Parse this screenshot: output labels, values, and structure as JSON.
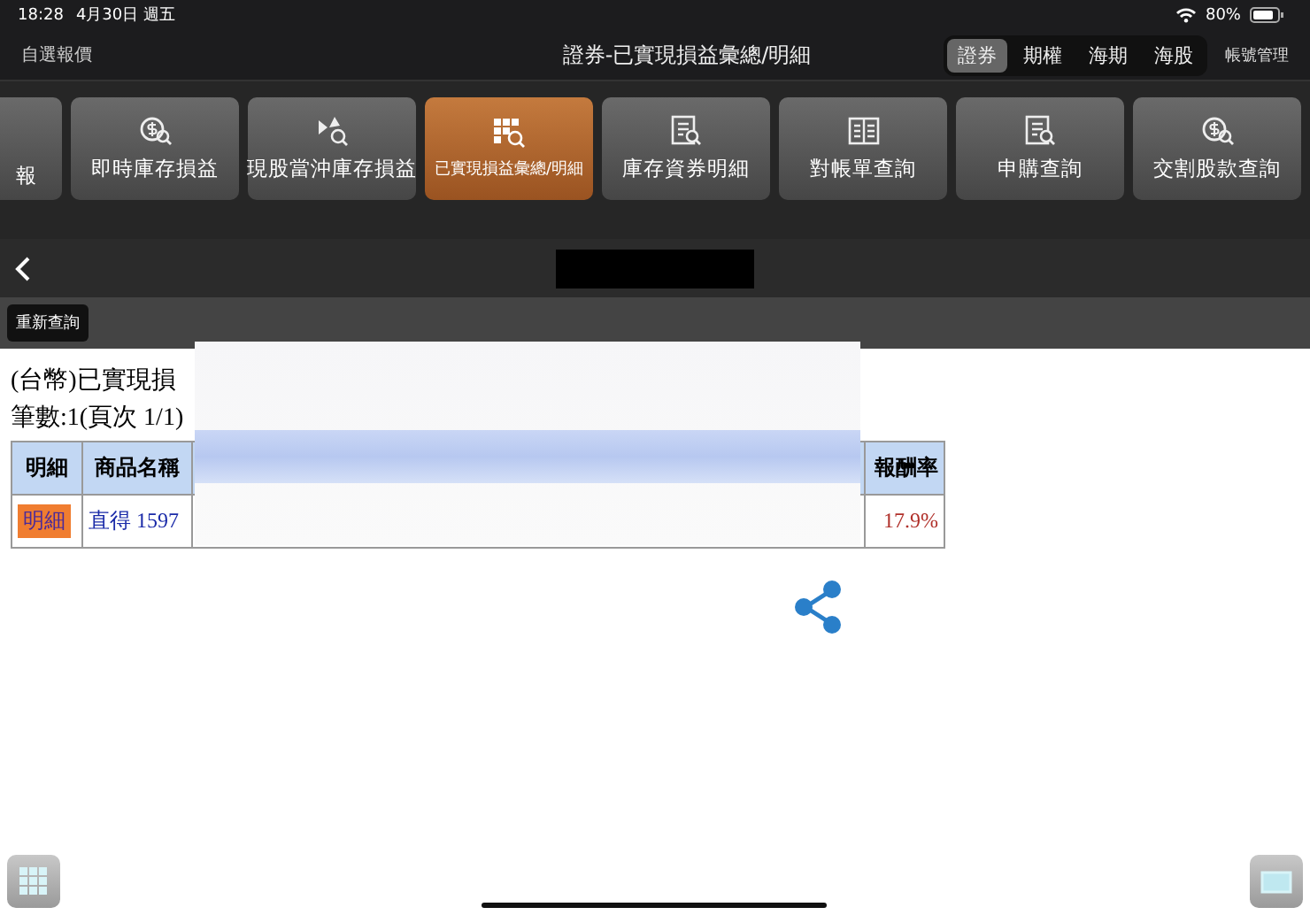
{
  "status_bar": {
    "time": "18:28",
    "date": "4月30日 週五",
    "battery": "80%"
  },
  "nav": {
    "left": "自選報價",
    "title": "證券-已實現損益彙總/明細",
    "segments": [
      {
        "label": "證券",
        "selected": true
      },
      {
        "label": "期權",
        "selected": false
      },
      {
        "label": "海期",
        "selected": false
      },
      {
        "label": "海股",
        "selected": false
      }
    ],
    "right": "帳號管理"
  },
  "tiles": [
    {
      "label": "報",
      "kind": "none",
      "selected": false
    },
    {
      "label": "即時庫存損益",
      "kind": "coin",
      "selected": false
    },
    {
      "label": "現股當沖庫存損益",
      "kind": "arrows",
      "selected": false
    },
    {
      "label": "已實現損益彙總/明細",
      "kind": "grid",
      "selected": true
    },
    {
      "label": "庫存資券明細",
      "kind": "doc",
      "selected": false
    },
    {
      "label": "對帳單查詢",
      "kind": "book",
      "selected": false
    },
    {
      "label": "申購查詢",
      "kind": "doc",
      "selected": false
    },
    {
      "label": "交割股款查詢",
      "kind": "coin",
      "selected": false
    }
  ],
  "toolbar": {
    "button": "重新查詢"
  },
  "report": {
    "title": "(台幣)已實現損",
    "count": "筆數:1(頁次 1/1)",
    "columns": [
      "明細",
      "商品名稱",
      "報酬率"
    ],
    "rows": [
      {
        "detail": "明細",
        "name": "直得 1597",
        "return": "17.9%"
      }
    ]
  }
}
